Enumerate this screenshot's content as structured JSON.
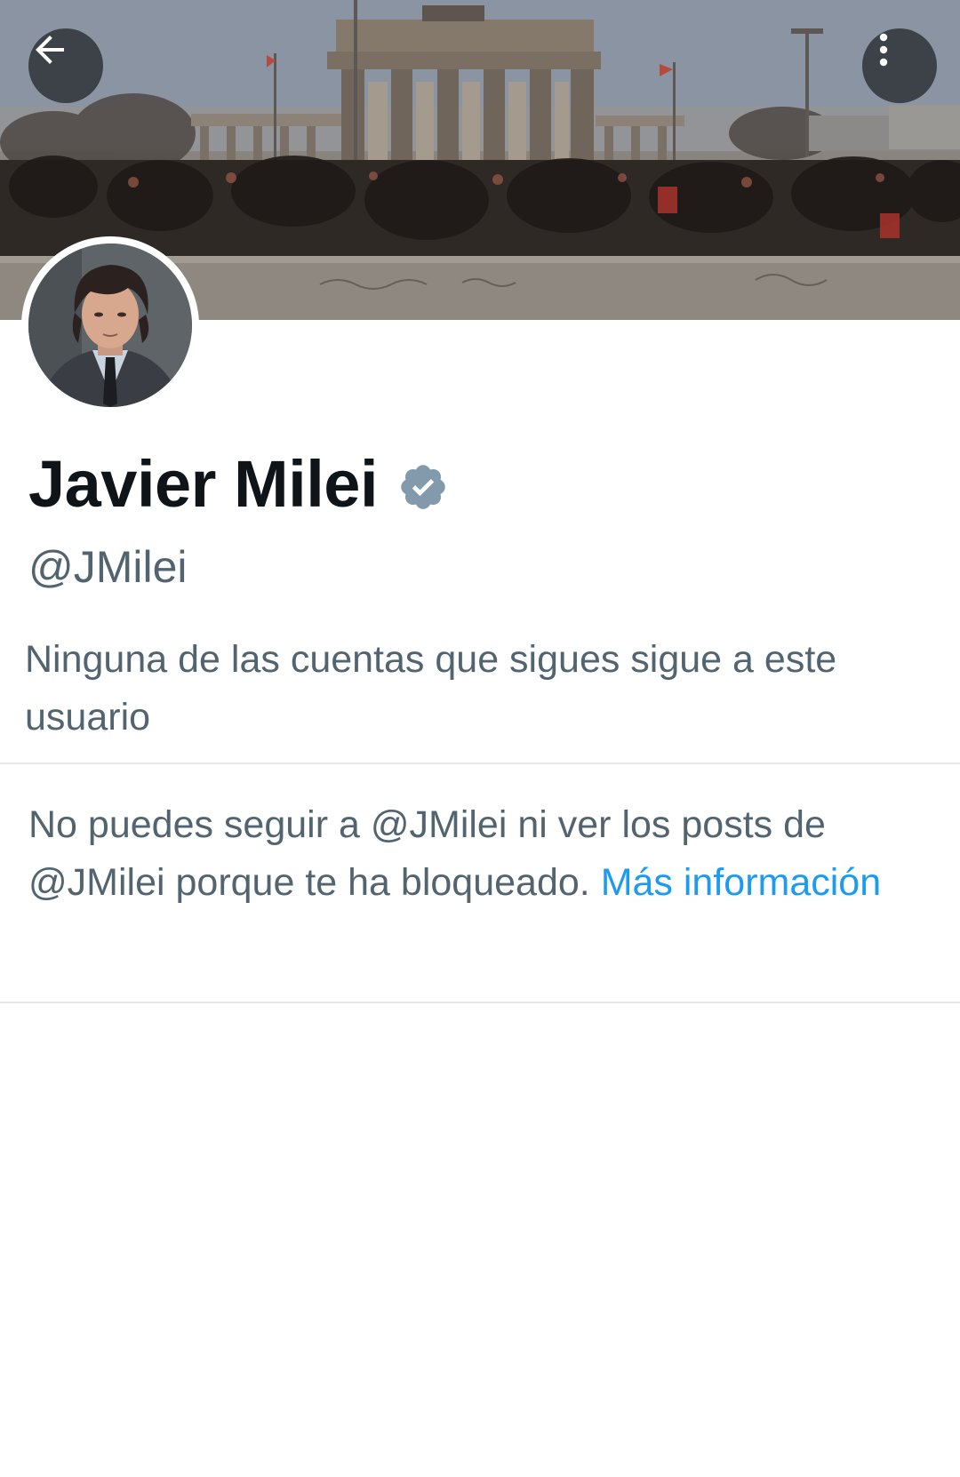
{
  "header": {
    "back_icon": "arrow-left-icon",
    "more_icon": "more-vertical-icon",
    "banner_icon": "banner-photo-crowd-at-gate"
  },
  "profile": {
    "name": "Javier Milei",
    "verified_icon": "verified-badge-icon",
    "verified_color": "#829aab",
    "handle": "@JMilei",
    "followers_note": "Ninguna de las cuentas que sigues sigue a este usuario"
  },
  "blocked": {
    "message": "No puedes seguir a @JMilei ni ver los posts de @JMilei porque te ha bloqueado.",
    "link_label": "Más información",
    "link_color": "#1d9bf0"
  }
}
